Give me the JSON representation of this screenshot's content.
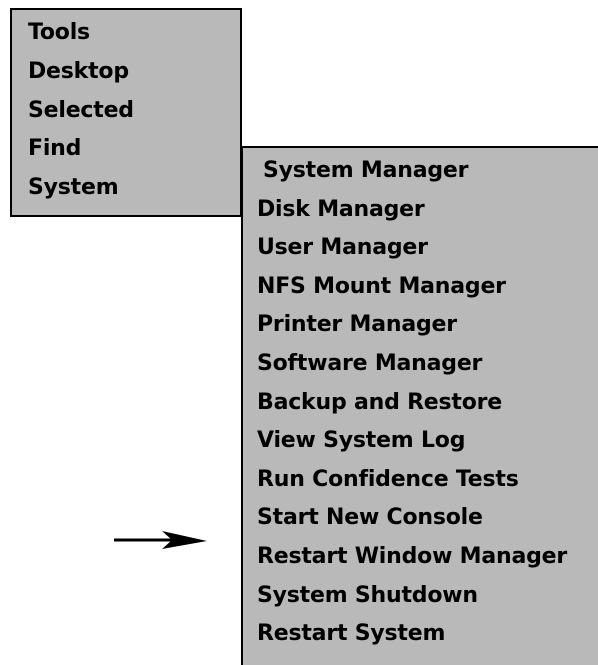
{
  "main_menu": {
    "items": [
      {
        "label": "Tools"
      },
      {
        "label": "Desktop"
      },
      {
        "label": "Selected"
      },
      {
        "label": "Find"
      },
      {
        "label": "System"
      }
    ]
  },
  "system_submenu": {
    "items": [
      {
        "label": "System Manager"
      },
      {
        "label": "Disk Manager"
      },
      {
        "label": "User Manager"
      },
      {
        "label": "NFS Mount Manager"
      },
      {
        "label": "Printer Manager"
      },
      {
        "label": "Software Manager"
      },
      {
        "label": "Backup and Restore"
      },
      {
        "label": "View System Log"
      },
      {
        "label": "Run Confidence Tests"
      },
      {
        "label": "Start New Console"
      },
      {
        "label": "Restart Window Manager"
      },
      {
        "label": "System Shutdown"
      },
      {
        "label": "Restart System"
      }
    ]
  },
  "colors": {
    "menu_background": "#b9b9b9",
    "menu_border": "#000000",
    "text": "#000000"
  },
  "icons": {
    "pointer": "arrow-right-icon"
  }
}
